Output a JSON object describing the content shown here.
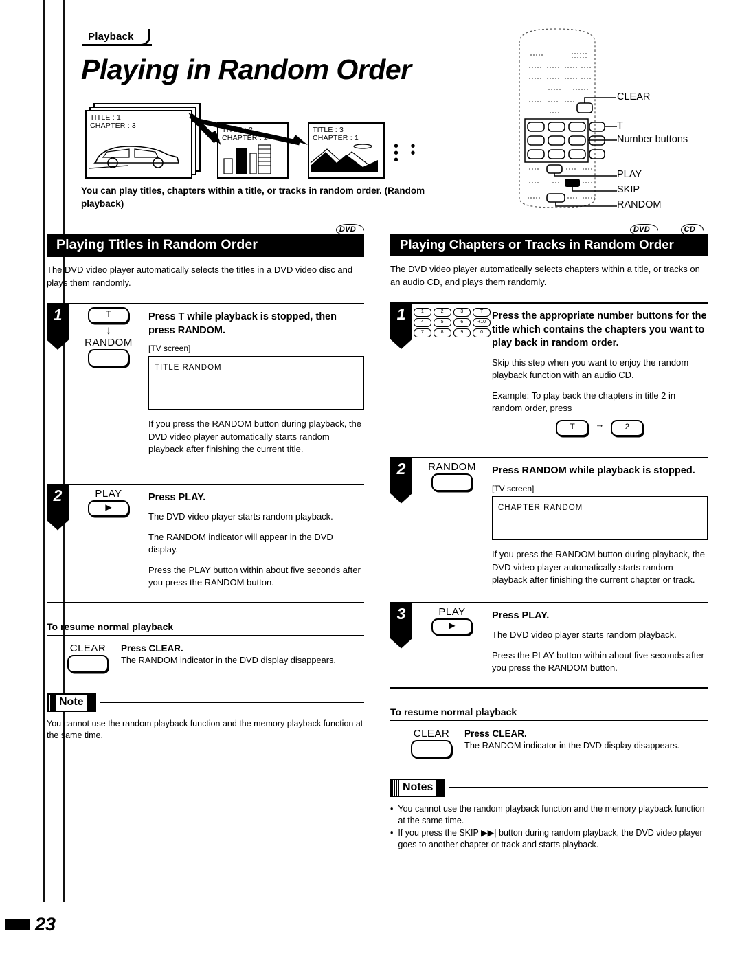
{
  "header": {
    "tab_label": "Playback",
    "title": "Playing in Random Order"
  },
  "illustration": {
    "panels": [
      {
        "title_line": "TITLE : 1",
        "chapter_line": "CHAPTER : 3"
      },
      {
        "title_line": "TITLE : 2",
        "chapter_line": "CHAPTER : 2"
      },
      {
        "title_line": "TITLE : 3",
        "chapter_line": "CHAPTER : 1"
      }
    ],
    "ellipsis": "• • • • •"
  },
  "lead_text": "You can play titles, chapters within a title, or tracks in random order. (Random playback)",
  "remote": {
    "callouts": [
      {
        "label": "CLEAR"
      },
      {
        "label": "T"
      },
      {
        "label": "Number buttons"
      },
      {
        "label": "PLAY"
      },
      {
        "label": "SKIP"
      },
      {
        "label": "RANDOM"
      }
    ],
    "keypad_rows": [
      [
        "1",
        "2",
        "3",
        "T"
      ],
      [
        "4",
        "5",
        "6",
        "+10"
      ],
      [
        "7",
        "8",
        "9",
        "0"
      ]
    ]
  },
  "left_column": {
    "media_badges": [
      "DVD"
    ],
    "section_title": "Playing Titles in Random Order",
    "intro": "The DVD video player automatically selects the titles in a DVD video disc and plays them randomly.",
    "steps": [
      {
        "number": "1",
        "icon_top_label": "T",
        "icon_arrow": "↓",
        "icon_bottom_label": "RANDOM",
        "title": "Press T while playback is stopped, then press RANDOM.",
        "tv_label": "[TV screen]",
        "tv_text": "TITLE RANDOM",
        "paragraphs": [
          "If you press the RANDOM button during playback, the DVD video player automatically starts random playback after finishing the current title."
        ]
      },
      {
        "number": "2",
        "icon_top_label": "PLAY",
        "title": "Press PLAY.",
        "paragraphs": [
          "The DVD video player starts random playback.",
          "The RANDOM indicator will appear in the DVD display.",
          "Press the PLAY button within about five seconds after you press the RANDOM button."
        ]
      }
    ],
    "resume": {
      "heading": "To resume normal playback",
      "icon_label": "CLEAR",
      "title": "Press CLEAR.",
      "text": "The RANDOM indicator in the DVD display disappears."
    },
    "note": {
      "badge": "Note",
      "items": [
        "You cannot use the random playback function and the memory playback function at the same time."
      ]
    }
  },
  "right_column": {
    "media_badges": [
      "DVD",
      "CD"
    ],
    "section_title": "Playing Chapters or Tracks in Random Order",
    "intro": "The DVD video player automatically selects chapters within a title, or tracks on an audio CD, and plays them randomly.",
    "steps": [
      {
        "number": "1",
        "title": "Press the appropriate number buttons for the title which contains the chapters you want to play back in random order.",
        "paragraphs": [
          "Skip this step when you want to enjoy the random playback function with an audio CD."
        ],
        "example_label": "Example: To play back the chapters in title 2 in random order, press",
        "example_keys": [
          "T",
          "2"
        ],
        "example_arrow": "→"
      },
      {
        "number": "2",
        "icon_top_label": "RANDOM",
        "title": "Press RANDOM while playback is stopped.",
        "tv_label": "[TV screen]",
        "tv_text": "CHAPTER RANDOM",
        "paragraphs": [
          "If you press the RANDOM button during playback, the DVD video player automatically starts random playback after finishing the current chapter or track."
        ]
      },
      {
        "number": "3",
        "icon_top_label": "PLAY",
        "title": "Press PLAY.",
        "paragraphs": [
          "The DVD video player starts random playback.",
          "Press the PLAY button within about five seconds after you press the RANDOM button."
        ]
      }
    ],
    "resume": {
      "heading": "To resume normal playback",
      "icon_label": "CLEAR",
      "title": "Press CLEAR.",
      "text": "The RANDOM indicator in the DVD display disappears."
    },
    "notes": {
      "badge": "Notes",
      "bullet": "•",
      "items": [
        "You cannot use the random playback function and the memory playback function at the same time.",
        "If you press the SKIP ▶▶| button during random playback, the DVD video player goes to another chapter or track and starts playback."
      ]
    }
  },
  "footer": {
    "page_number": "23"
  }
}
